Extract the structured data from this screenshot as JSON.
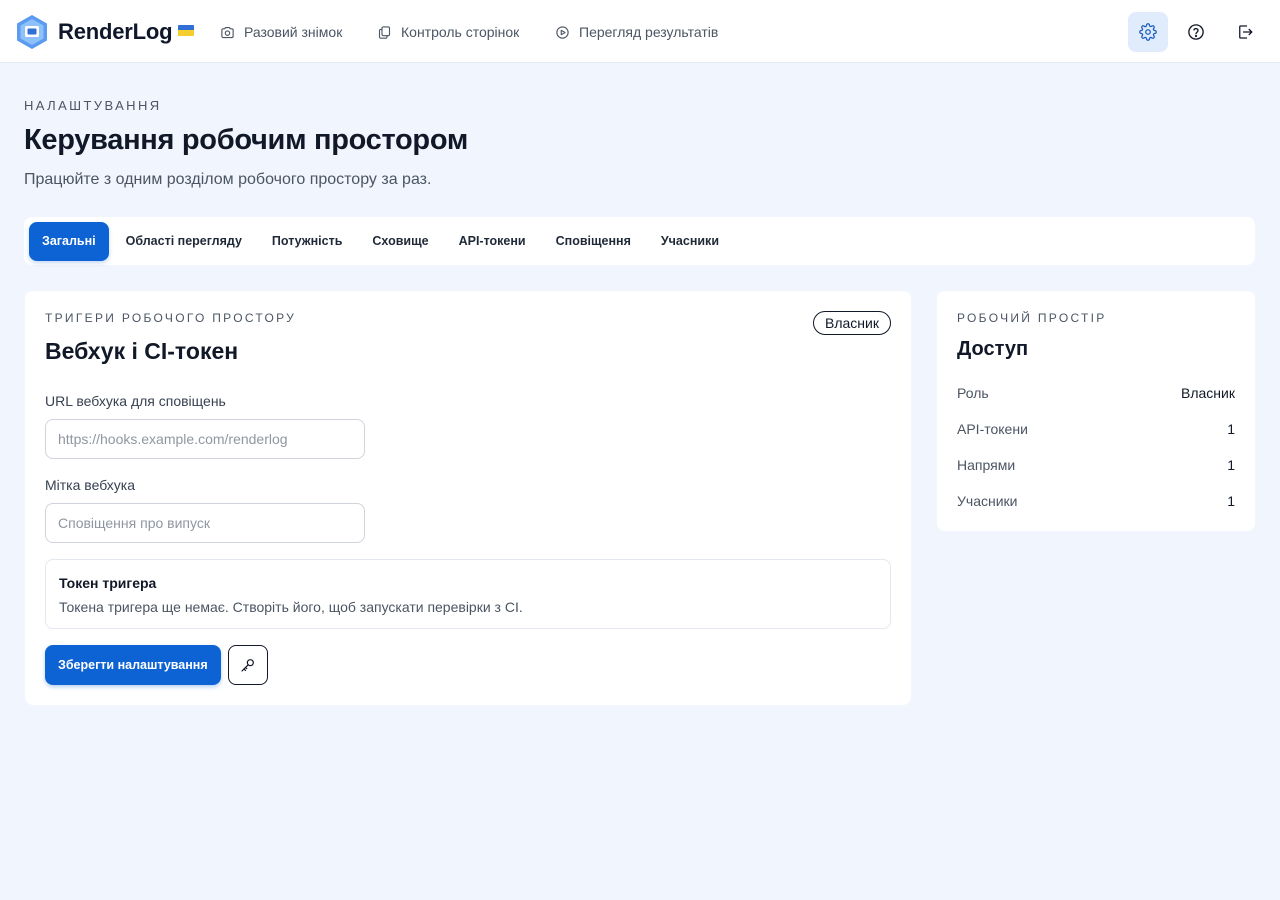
{
  "brand": {
    "name": "RenderLog",
    "flag_icon": "ukraine-flag-icon",
    "logo_icon": "renderlog-logo-icon"
  },
  "nav": [
    {
      "label": "Разовий знімок",
      "icon": "camera-icon"
    },
    {
      "label": "Контроль сторінок",
      "icon": "pages-copy-icon"
    },
    {
      "label": "Перегляд результатів",
      "icon": "play-circle-icon"
    }
  ],
  "toolbar_icons": [
    "gear-icon",
    "help-circle-icon",
    "logout-icon"
  ],
  "page": {
    "eyebrow": "НАЛАШТУВАННЯ",
    "title": "Керування робочим простором",
    "subtitle": "Працюйте з одним розділом робочого простору за раз."
  },
  "tabs": [
    {
      "label": "Загальні",
      "active": true
    },
    {
      "label": "Області перегляду",
      "active": false
    },
    {
      "label": "Потужність",
      "active": false
    },
    {
      "label": "Сховище",
      "active": false
    },
    {
      "label": "API-токени",
      "active": false
    },
    {
      "label": "Сповіщення",
      "active": false
    },
    {
      "label": "Учасники",
      "active": false
    }
  ],
  "main_card": {
    "eyebrow": "ТРИГЕРИ РОБОЧОГО ПРОСТОРУ",
    "title": "Вебхук і CI-токен",
    "role_badge": "Власник",
    "webhook_url": {
      "label": "URL вебхука для сповіщень",
      "value": "",
      "placeholder": "https://hooks.example.com/renderlog"
    },
    "webhook_label": {
      "label": "Мітка вебхука",
      "value": "",
      "placeholder": "Сповіщення про випуск"
    },
    "token": {
      "title": "Токен тригера",
      "description": "Токена тригера ще немає. Створіть його, щоб запускати перевірки з CI."
    },
    "save_label": "Зберегти налаштування",
    "key_icon": "key-icon"
  },
  "side_card": {
    "eyebrow": "РОБОЧИЙ ПРОСТІР",
    "title": "Доступ",
    "rows": [
      {
        "key": "Роль",
        "value": "Власник"
      },
      {
        "key": "API-токени",
        "value": "1"
      },
      {
        "key": "Напрями",
        "value": "1"
      },
      {
        "key": "Учасники",
        "value": "1"
      }
    ]
  },
  "colors": {
    "accent": "#0e63d4",
    "background": "#f1f5fd",
    "card": "#ffffff",
    "text": "#111827",
    "muted": "#4b5563"
  }
}
